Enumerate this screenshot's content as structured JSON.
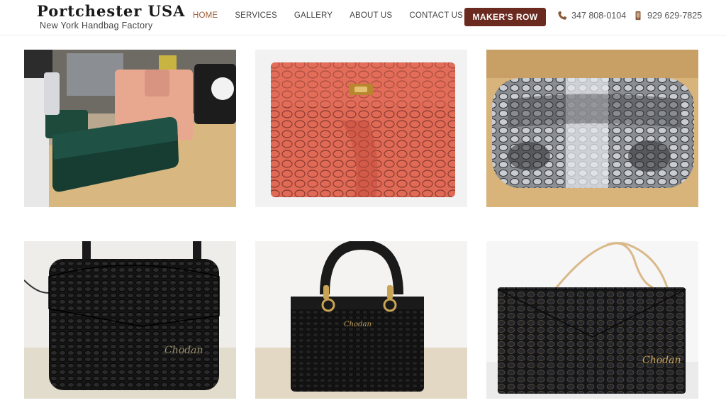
{
  "brand": {
    "title": "Portchester USA",
    "subtitle": "New York Handbag Factory"
  },
  "nav": {
    "items": [
      {
        "label": "HOME",
        "active": true
      },
      {
        "label": "SERVICES",
        "active": false
      },
      {
        "label": "GALLERY",
        "active": false
      },
      {
        "label": "ABOUT US",
        "active": false
      },
      {
        "label": "CONTACT US",
        "active": false
      }
    ],
    "makers_row": "MAKER'S ROW"
  },
  "contact": {
    "phone1": "347 808-0104",
    "phone2": "929 629-7825"
  },
  "gallery": {
    "signature": "Chodan",
    "photos": [
      {
        "subject": "green croc clutch on desk"
      },
      {
        "subject": "coral python clutch"
      },
      {
        "subject": "grey python clutch"
      },
      {
        "subject": "black python crossbody"
      },
      {
        "subject": "black python top-handle bag"
      },
      {
        "subject": "black python envelope clutch"
      }
    ]
  },
  "colors": {
    "accent": "#9b5a34",
    "button": "#6b2a20"
  }
}
